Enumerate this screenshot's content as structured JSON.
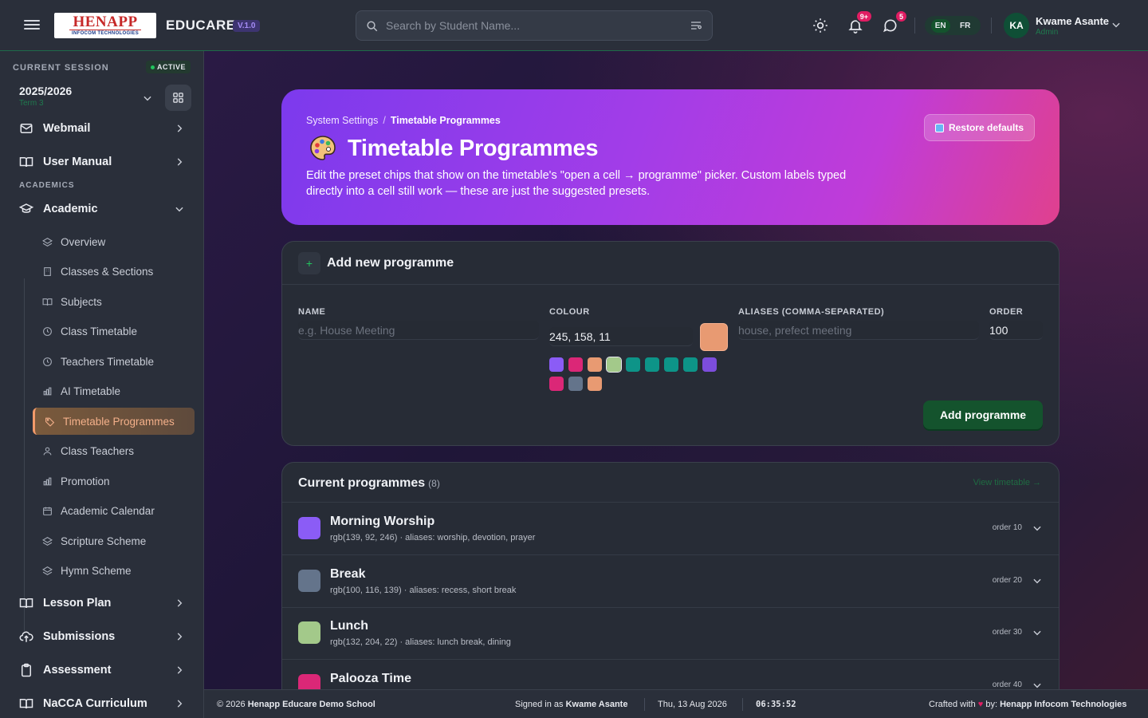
{
  "header": {
    "logo_line1": "HENAPP",
    "logo_line2": "INFOCOM TECHNOLOGIES",
    "brand": "EDUCARE",
    "version": "V.1.0",
    "search_placeholder": "Search by Student Name...",
    "notifications_badge": "9+",
    "messages_badge": "5",
    "lang_en": "EN",
    "lang_fr": "FR",
    "user_initials": "KA",
    "user_name": "Kwame Asante",
    "user_role": "Admin"
  },
  "sidebar": {
    "session_label": "CURRENT SESSION",
    "session_status": "ACTIVE",
    "session_year": "2025/2026",
    "session_term": "Term 3",
    "items_top": [
      {
        "label": "Webmail",
        "icon": "mail-icon"
      },
      {
        "label": "User Manual",
        "icon": "book-icon"
      }
    ],
    "section_academics": "ACADEMICS",
    "academic_label": "Academic",
    "academic_sub": [
      {
        "label": "Overview",
        "icon": "layers-icon"
      },
      {
        "label": "Classes & Sections",
        "icon": "building-icon"
      },
      {
        "label": "Subjects",
        "icon": "book-icon"
      },
      {
        "label": "Class Timetable",
        "icon": "clock-icon"
      },
      {
        "label": "Teachers Timetable",
        "icon": "clock-icon"
      },
      {
        "label": "AI Timetable",
        "icon": "chart-icon"
      },
      {
        "label": "Timetable Programmes",
        "icon": "tag-icon"
      },
      {
        "label": "Class Teachers",
        "icon": "user-icon"
      },
      {
        "label": "Promotion",
        "icon": "chart-icon"
      },
      {
        "label": "Academic Calendar",
        "icon": "calendar-icon"
      },
      {
        "label": "Scripture Scheme",
        "icon": "layers-icon"
      },
      {
        "label": "Hymn Scheme",
        "icon": "layers-icon"
      }
    ],
    "items_bottom": [
      {
        "label": "Lesson Plan",
        "icon": "book-icon"
      },
      {
        "label": "Submissions",
        "icon": "upload-cloud-icon"
      },
      {
        "label": "Assessment",
        "icon": "clipboard-icon"
      },
      {
        "label": "NaCCA Curriculum",
        "icon": "book-icon"
      }
    ]
  },
  "hero": {
    "crumb_parent": "System Settings",
    "crumb_sep": "/",
    "crumb_current": "Timetable Programmes",
    "title": "Timetable Programmes",
    "description": "Edit the preset chips that show on the timetable's \"open a cell → programme\" picker. Custom labels typed directly into a cell still work — these are just the suggested presets.",
    "restore_label": "Restore defaults"
  },
  "add_form": {
    "title": "Add new programme",
    "plus": "+",
    "name_label": "NAME",
    "name_placeholder": "e.g. House Meeting",
    "colour_label": "COLOUR",
    "colour_value": "245, 158, 11",
    "aliases_label": "ALIASES (COMMA-SEPARATED)",
    "aliases_placeholder": "house, prefect meeting",
    "order_label": "ORDER",
    "order_value": "100",
    "submit_label": "Add programme",
    "selected_colour": "#e89a72",
    "swatches": [
      "#8b5cf6",
      "#db2777",
      "#e89a72",
      "#a3c98a",
      "#0d9488",
      "#0d9488",
      "#0d9488",
      "#0d9488",
      "#7c4ddc",
      "#db2777",
      "#64748b",
      "#e89a72"
    ]
  },
  "programmes": {
    "title": "Current programmes",
    "count": "(8)",
    "view_link": "View timetable →",
    "items": [
      {
        "name": "Morning Worship",
        "meta": "rgb(139, 92, 246) · aliases: worship, devotion, prayer",
        "order": "order 10",
        "color": "#8b5cf6"
      },
      {
        "name": "Break",
        "meta": "rgb(100, 116, 139) · aliases: recess, short break",
        "order": "order 20",
        "color": "#64748b"
      },
      {
        "name": "Lunch",
        "meta": "rgb(132, 204, 22) · aliases: lunch break, dining",
        "order": "order 30",
        "color": "#a3c98a"
      },
      {
        "name": "Palooza Time",
        "meta": "",
        "order": "order 40",
        "color": "#db2777"
      }
    ]
  },
  "footer": {
    "copyright": "© 2026",
    "school": "Henapp Educare Demo School",
    "signed_in_prefix": "Signed in as",
    "signed_in_user": "Kwame Asante",
    "date": "Thu, 13 Aug 2026",
    "time": "06:35:52",
    "crafted_prefix": "Crafted with",
    "heart": "♥",
    "crafted_by": "by:",
    "company": "Henapp Infocom Technologies"
  }
}
